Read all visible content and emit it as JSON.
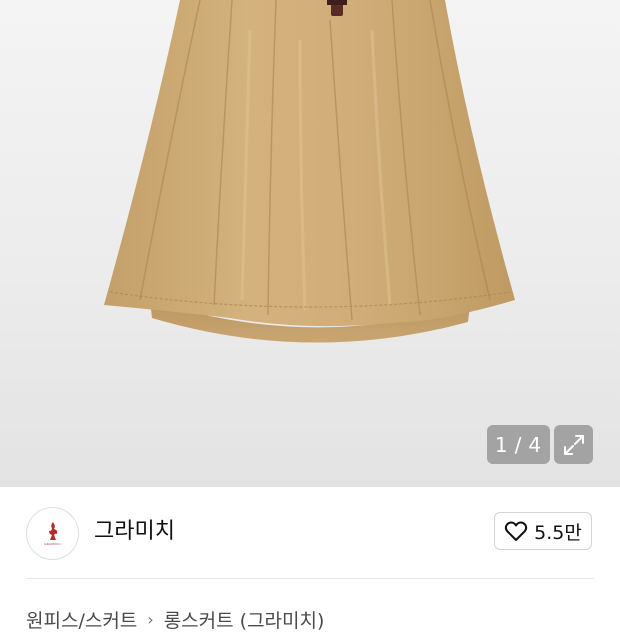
{
  "gallery": {
    "current_page": "1",
    "separator": "/",
    "total_pages": "4"
  },
  "shop": {
    "name": "그라미치",
    "logo_text": "GRAMICCI"
  },
  "like": {
    "count": "5.5만"
  },
  "breadcrumb": {
    "items": [
      "원피스/스커트",
      "롱스커트 (그라미치)"
    ]
  },
  "colors": {
    "skirt": "#cfac78",
    "overlay": "#6e6e6e",
    "logo": "#b22a2a"
  }
}
